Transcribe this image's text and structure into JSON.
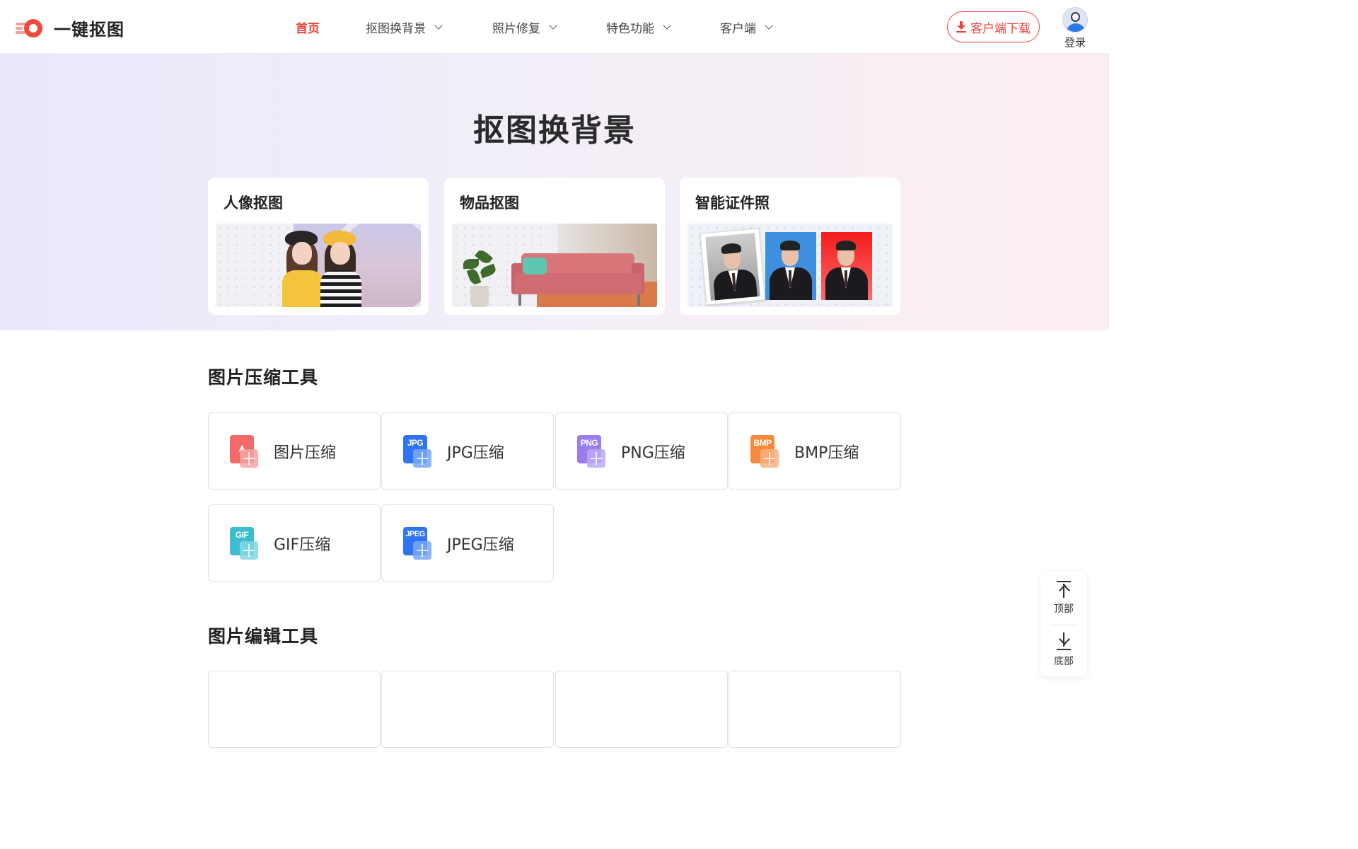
{
  "header": {
    "logo_text": "一键抠图",
    "nav": [
      {
        "label": "首页",
        "active": true
      },
      {
        "label": "抠图换背景"
      },
      {
        "label": "照片修复"
      },
      {
        "label": "特色功能"
      },
      {
        "label": "客户端"
      }
    ],
    "download_label": "客户端下载",
    "login_label": "登录",
    "accent_color": "#f0423a"
  },
  "hero": {
    "title": "抠图换背景",
    "cards": [
      {
        "title": "人像抠图"
      },
      {
        "title": "物品抠图"
      },
      {
        "title": "智能证件照"
      }
    ]
  },
  "compress": {
    "title": "图片压缩工具",
    "tools": [
      {
        "label": "图片压缩",
        "icon": "image-compress-icon",
        "badge": "",
        "color": "#f26a6a"
      },
      {
        "label": "JPG压缩",
        "icon": "jpg-compress-icon",
        "badge": "JPG",
        "color": "#2f74f0"
      },
      {
        "label": "PNG压缩",
        "icon": "png-compress-icon",
        "badge": "PNG",
        "color": "#9a7ef0"
      },
      {
        "label": "BMP压缩",
        "icon": "bmp-compress-icon",
        "badge": "BMP",
        "color": "#f58a3c"
      },
      {
        "label": "GIF压缩",
        "icon": "gif-compress-icon",
        "badge": "GIF",
        "color": "#3cbccf"
      },
      {
        "label": "JPEG压缩",
        "icon": "jpeg-compress-icon",
        "badge": "JPEG",
        "color": "#2f74f0"
      }
    ]
  },
  "edit": {
    "title": "图片编辑工具"
  },
  "side": {
    "top_label": "顶部",
    "bottom_label": "底部"
  }
}
